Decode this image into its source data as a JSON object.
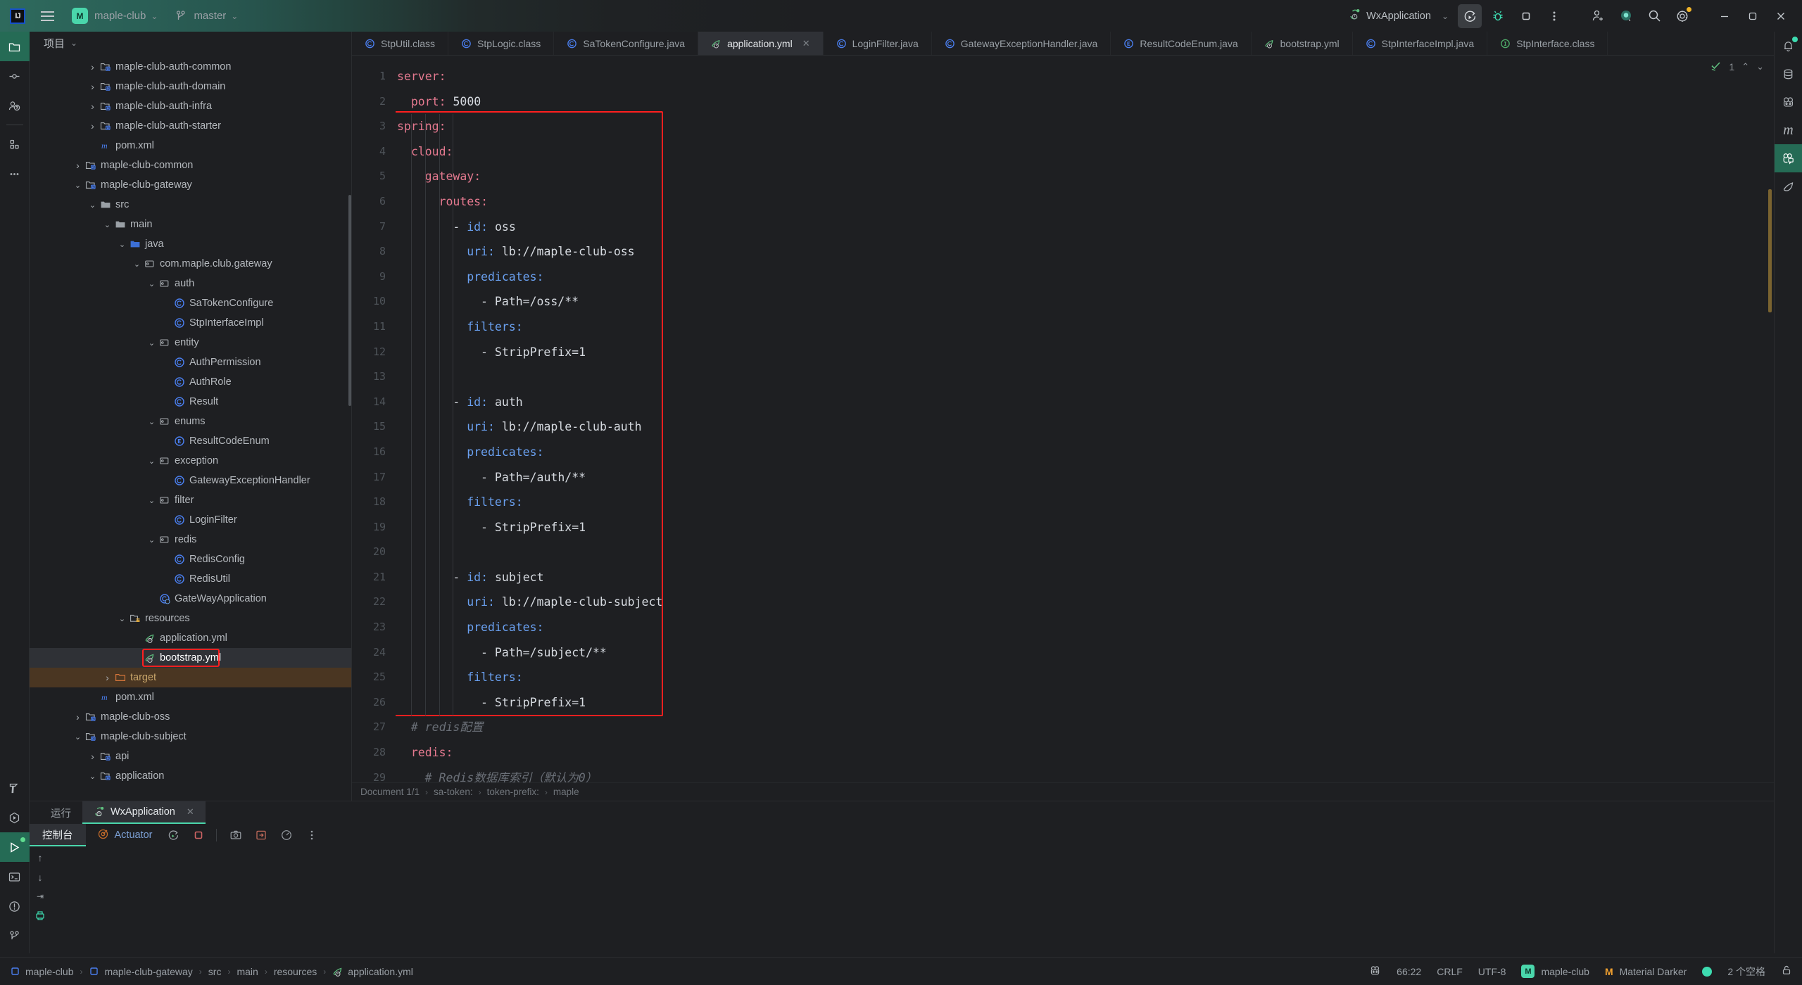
{
  "titlebar": {
    "app_icon": "intellij-idea-logo",
    "menu_icon": "hamburger-menu-icon",
    "project_badge": "M",
    "project_name": "maple-club",
    "branch_icon": "vcs-branch-icon",
    "branch_name": "master",
    "run_config": "WxApplication",
    "buttons": [
      {
        "name": "run-button",
        "icon": "run-with-coverage-icon"
      },
      {
        "name": "debug-button",
        "icon": "debug-bug-icon"
      },
      {
        "name": "stop-button",
        "icon": "stop-square-icon"
      },
      {
        "name": "more-button",
        "icon": "more-vertical-icon"
      },
      {
        "name": "share-button",
        "icon": "add-user-icon"
      },
      {
        "name": "ai-assistant-button",
        "icon": "ai-assistant-icon"
      },
      {
        "name": "search-button",
        "icon": "search-icon"
      },
      {
        "name": "settings-button",
        "icon": "gear-icon"
      },
      {
        "name": "minimize-button",
        "icon": "minimize-icon"
      },
      {
        "name": "maximize-button",
        "icon": "restore-window-icon"
      },
      {
        "name": "close-button",
        "icon": "close-x-icon"
      }
    ]
  },
  "left_rail": {
    "top": [
      {
        "name": "project-tool-button",
        "icon": "folder-icon",
        "selected": true
      },
      {
        "name": "commit-tool-button",
        "icon": "commit-node-icon",
        "selected": false
      },
      {
        "name": "pull-requests-button",
        "icon": "pull-request-icon",
        "selected": false
      },
      {
        "name": "services-button",
        "icon": "services-grid-icon",
        "selected": false
      },
      {
        "name": "more-tool-windows-button",
        "icon": "more-horizontal-icon",
        "selected": false
      }
    ],
    "bottom": [
      {
        "name": "build-tool-button",
        "icon": "hammer-icon",
        "selected": false
      },
      {
        "name": "run-anything-button",
        "icon": "play-hex-icon",
        "selected": false
      },
      {
        "name": "run-tool-button",
        "icon": "play-triangle-icon",
        "selected": true
      },
      {
        "name": "terminal-button",
        "icon": "terminal-icon",
        "selected": false
      },
      {
        "name": "problems-button",
        "icon": "warning-circle-icon",
        "selected": false
      },
      {
        "name": "version-control-button",
        "icon": "branch-icon",
        "selected": false
      }
    ]
  },
  "right_rail": {
    "items": [
      {
        "name": "notifications-button",
        "icon": "bell-icon",
        "badge": true
      },
      {
        "name": "database-button",
        "icon": "database-icon",
        "badge": false
      },
      {
        "name": "bean-validation-button",
        "icon": "spring-beans-icon",
        "badge": false
      },
      {
        "name": "maven-button",
        "icon": "maven-m-icon",
        "badge": false
      },
      {
        "name": "ai-chat-button",
        "icon": "ai-chat-icon",
        "badge": false,
        "selected": true
      },
      {
        "name": "spring-button",
        "icon": "spring-leaf-icon",
        "badge": false
      }
    ]
  },
  "project_panel": {
    "title": "项目",
    "caret_icon": "chevron-down-icon",
    "tree": [
      {
        "depth": 3,
        "label": "maple-club-auth-common",
        "icon": "module-folder-icon",
        "arrow": "collapsed"
      },
      {
        "depth": 3,
        "label": "maple-club-auth-domain",
        "icon": "module-folder-icon",
        "arrow": "collapsed"
      },
      {
        "depth": 3,
        "label": "maple-club-auth-infra",
        "icon": "module-folder-icon",
        "arrow": "collapsed"
      },
      {
        "depth": 3,
        "label": "maple-club-auth-starter",
        "icon": "module-folder-icon",
        "arrow": "collapsed"
      },
      {
        "depth": 3,
        "label": "pom.xml",
        "icon": "maven-pom-icon",
        "arrow": "none"
      },
      {
        "depth": 2,
        "label": "maple-club-common",
        "icon": "module-folder-icon",
        "arrow": "collapsed"
      },
      {
        "depth": 2,
        "label": "maple-club-gateway",
        "icon": "module-folder-icon",
        "arrow": "expanded"
      },
      {
        "depth": 3,
        "label": "src",
        "icon": "folder-icon",
        "arrow": "expanded"
      },
      {
        "depth": 4,
        "label": "main",
        "icon": "folder-icon",
        "arrow": "expanded"
      },
      {
        "depth": 5,
        "label": "java",
        "icon": "source-folder-icon",
        "arrow": "expanded"
      },
      {
        "depth": 6,
        "label": "com.maple.club.gateway",
        "icon": "package-icon",
        "arrow": "expanded"
      },
      {
        "depth": 7,
        "label": "auth",
        "icon": "package-icon",
        "arrow": "expanded"
      },
      {
        "depth": 8,
        "label": "SaTokenConfigure",
        "icon": "java-class-icon",
        "arrow": "none"
      },
      {
        "depth": 8,
        "label": "StpInterfaceImpl",
        "icon": "java-class-icon",
        "arrow": "none"
      },
      {
        "depth": 7,
        "label": "entity",
        "icon": "package-icon",
        "arrow": "expanded"
      },
      {
        "depth": 8,
        "label": "AuthPermission",
        "icon": "java-class-icon",
        "arrow": "none"
      },
      {
        "depth": 8,
        "label": "AuthRole",
        "icon": "java-class-icon",
        "arrow": "none"
      },
      {
        "depth": 8,
        "label": "Result",
        "icon": "java-class-icon",
        "arrow": "none"
      },
      {
        "depth": 7,
        "label": "enums",
        "icon": "package-icon",
        "arrow": "expanded"
      },
      {
        "depth": 8,
        "label": "ResultCodeEnum",
        "icon": "java-enum-icon",
        "arrow": "none"
      },
      {
        "depth": 7,
        "label": "exception",
        "icon": "package-icon",
        "arrow": "expanded"
      },
      {
        "depth": 8,
        "label": "GatewayExceptionHandler",
        "icon": "java-class-icon",
        "arrow": "none"
      },
      {
        "depth": 7,
        "label": "filter",
        "icon": "package-icon",
        "arrow": "expanded"
      },
      {
        "depth": 8,
        "label": "LoginFilter",
        "icon": "java-class-icon",
        "arrow": "none"
      },
      {
        "depth": 7,
        "label": "redis",
        "icon": "package-icon",
        "arrow": "expanded"
      },
      {
        "depth": 8,
        "label": "RedisConfig",
        "icon": "java-class-icon",
        "arrow": "none"
      },
      {
        "depth": 8,
        "label": "RedisUtil",
        "icon": "java-class-icon",
        "arrow": "none"
      },
      {
        "depth": 7,
        "label": "GateWayApplication",
        "icon": "spring-boot-class-icon",
        "arrow": "none"
      },
      {
        "depth": 5,
        "label": "resources",
        "icon": "resources-folder-icon",
        "arrow": "expanded"
      },
      {
        "depth": 6,
        "label": "application.yml",
        "icon": "spring-yaml-icon",
        "arrow": "none"
      },
      {
        "depth": 6,
        "label": "bootstrap.yml",
        "icon": "spring-yaml-icon",
        "arrow": "none",
        "boxed": true,
        "selected": true
      },
      {
        "depth": 4,
        "label": "target",
        "icon": "excluded-folder-icon",
        "arrow": "collapsed",
        "excluded": true
      },
      {
        "depth": 3,
        "label": "pom.xml",
        "icon": "maven-pom-icon",
        "arrow": "none"
      },
      {
        "depth": 2,
        "label": "maple-club-oss",
        "icon": "module-folder-icon",
        "arrow": "collapsed"
      },
      {
        "depth": 2,
        "label": "maple-club-subject",
        "icon": "module-folder-icon",
        "arrow": "expanded"
      },
      {
        "depth": 3,
        "label": "api",
        "icon": "module-folder-icon",
        "arrow": "collapsed"
      },
      {
        "depth": 3,
        "label": "application",
        "icon": "module-folder-icon",
        "arrow": "expanded"
      }
    ]
  },
  "editor_tabs": [
    {
      "label": "StpUtil.class",
      "icon": "java-class-icon",
      "active": false,
      "closable": false
    },
    {
      "label": "StpLogic.class",
      "icon": "java-class-icon",
      "active": false,
      "closable": false
    },
    {
      "label": "SaTokenConfigure.java",
      "icon": "java-class-icon",
      "active": false,
      "closable": false
    },
    {
      "label": "application.yml",
      "icon": "spring-yaml-icon",
      "active": true,
      "closable": true
    },
    {
      "label": "LoginFilter.java",
      "icon": "java-class-icon",
      "active": false,
      "closable": false
    },
    {
      "label": "GatewayExceptionHandler.java",
      "icon": "java-class-icon",
      "active": false,
      "closable": false
    },
    {
      "label": "ResultCodeEnum.java",
      "icon": "java-enum-icon",
      "active": false,
      "closable": false
    },
    {
      "label": "bootstrap.yml",
      "icon": "spring-yaml-icon",
      "active": false,
      "closable": false
    },
    {
      "label": "StpInterfaceImpl.java",
      "icon": "java-class-icon",
      "active": false,
      "closable": false
    },
    {
      "label": "StpInterface.class",
      "icon": "java-interface-icon",
      "active": false,
      "closable": false
    }
  ],
  "editor": {
    "inspection_count": "1",
    "inspection_icon": "inspection-check-icon",
    "prev_icon": "chevron-up-icon",
    "next_icon": "chevron-down-icon",
    "lines": [
      {
        "n": 1,
        "indent": 0,
        "tokens": [
          {
            "t": "server",
            "c": "k"
          },
          {
            "t": ":",
            "c": "k"
          }
        ]
      },
      {
        "n": 2,
        "indent": 1,
        "tokens": [
          {
            "t": "port",
            "c": "k"
          },
          {
            "t": ":",
            "c": "k"
          },
          {
            "t": " 5000",
            "c": "v"
          }
        ]
      },
      {
        "n": 3,
        "indent": 0,
        "tokens": [
          {
            "t": "spring",
            "c": "k"
          },
          {
            "t": ":",
            "c": "k"
          }
        ]
      },
      {
        "n": 4,
        "indent": 1,
        "tokens": [
          {
            "t": "cloud",
            "c": "k"
          },
          {
            "t": ":",
            "c": "k"
          }
        ]
      },
      {
        "n": 5,
        "indent": 2,
        "tokens": [
          {
            "t": "gateway",
            "c": "k"
          },
          {
            "t": ":",
            "c": "k"
          }
        ]
      },
      {
        "n": 6,
        "indent": 3,
        "tokens": [
          {
            "t": "routes",
            "c": "k"
          },
          {
            "t": ":",
            "c": "k"
          }
        ]
      },
      {
        "n": 7,
        "indent": 4,
        "tokens": [
          {
            "t": "- ",
            "c": "dash"
          },
          {
            "t": "id",
            "c": "k2"
          },
          {
            "t": ":",
            "c": "k2"
          },
          {
            "t": " oss",
            "c": "v"
          }
        ]
      },
      {
        "n": 8,
        "indent": 5,
        "tokens": [
          {
            "t": "uri",
            "c": "k2"
          },
          {
            "t": ":",
            "c": "k2"
          },
          {
            "t": " lb://maple-club-oss",
            "c": "v"
          }
        ]
      },
      {
        "n": 9,
        "indent": 5,
        "tokens": [
          {
            "t": "predicates",
            "c": "k2"
          },
          {
            "t": ":",
            "c": "k2"
          }
        ]
      },
      {
        "n": 10,
        "indent": 6,
        "tokens": [
          {
            "t": "- Path=/oss/**",
            "c": "v"
          }
        ]
      },
      {
        "n": 11,
        "indent": 5,
        "tokens": [
          {
            "t": "filters",
            "c": "k2"
          },
          {
            "t": ":",
            "c": "k2"
          }
        ]
      },
      {
        "n": 12,
        "indent": 6,
        "tokens": [
          {
            "t": "- StripPrefix=1",
            "c": "v"
          }
        ]
      },
      {
        "n": 13,
        "indent": 0,
        "tokens": []
      },
      {
        "n": 14,
        "indent": 4,
        "tokens": [
          {
            "t": "- ",
            "c": "dash"
          },
          {
            "t": "id",
            "c": "k2"
          },
          {
            "t": ":",
            "c": "k2"
          },
          {
            "t": " auth",
            "c": "v"
          }
        ]
      },
      {
        "n": 15,
        "indent": 5,
        "tokens": [
          {
            "t": "uri",
            "c": "k2"
          },
          {
            "t": ":",
            "c": "k2"
          },
          {
            "t": " lb://maple-club-auth",
            "c": "v"
          }
        ]
      },
      {
        "n": 16,
        "indent": 5,
        "tokens": [
          {
            "t": "predicates",
            "c": "k2"
          },
          {
            "t": ":",
            "c": "k2"
          }
        ]
      },
      {
        "n": 17,
        "indent": 5,
        "tokens": [
          {
            "t": "  - Path=/auth/**",
            "c": "v"
          }
        ]
      },
      {
        "n": 18,
        "indent": 5,
        "tokens": [
          {
            "t": "filters",
            "c": "k2"
          },
          {
            "t": ":",
            "c": "k2"
          }
        ]
      },
      {
        "n": 19,
        "indent": 5,
        "tokens": [
          {
            "t": "  - StripPrefix=1",
            "c": "v"
          }
        ]
      },
      {
        "n": 20,
        "indent": 0,
        "tokens": []
      },
      {
        "n": 21,
        "indent": 4,
        "tokens": [
          {
            "t": "- ",
            "c": "dash"
          },
          {
            "t": "id",
            "c": "k2"
          },
          {
            "t": ":",
            "c": "k2"
          },
          {
            "t": " subject",
            "c": "v"
          }
        ]
      },
      {
        "n": 22,
        "indent": 5,
        "tokens": [
          {
            "t": "uri",
            "c": "k2"
          },
          {
            "t": ":",
            "c": "k2"
          },
          {
            "t": " lb://maple-club-subject",
            "c": "v"
          }
        ]
      },
      {
        "n": 23,
        "indent": 5,
        "tokens": [
          {
            "t": "predicates",
            "c": "k2"
          },
          {
            "t": ":",
            "c": "k2"
          }
        ]
      },
      {
        "n": 24,
        "indent": 5,
        "tokens": [
          {
            "t": "  - Path=/subject/**",
            "c": "v"
          }
        ]
      },
      {
        "n": 25,
        "indent": 5,
        "tokens": [
          {
            "t": "filters",
            "c": "k2"
          },
          {
            "t": ":",
            "c": "k2"
          }
        ]
      },
      {
        "n": 26,
        "indent": 5,
        "tokens": [
          {
            "t": "  - StripPrefix=1",
            "c": "v"
          }
        ]
      },
      {
        "n": 27,
        "indent": 1,
        "tokens": [
          {
            "t": "# redis配置",
            "c": "cmt"
          }
        ]
      },
      {
        "n": 28,
        "indent": 1,
        "tokens": [
          {
            "t": "redis",
            "c": "k"
          },
          {
            "t": ":",
            "c": "k"
          }
        ]
      },
      {
        "n": 29,
        "indent": 2,
        "tokens": [
          {
            "t": "# Redis数据库索引（默认为0）",
            "c": "cmt"
          }
        ]
      }
    ]
  },
  "breadcrumb": {
    "items": [
      "Document 1/1",
      "sa-token:",
      "token-prefix:",
      "maple"
    ]
  },
  "bottom_panel": {
    "tabs": [
      {
        "label": "运行",
        "active": false,
        "icon": null,
        "closable": false
      },
      {
        "label": "WxApplication",
        "active": true,
        "icon": "spring-boot-run-icon",
        "closable": true
      }
    ],
    "console_tab": "控制台",
    "actuator_tab": "Actuator",
    "actuator_icon": "actuator-target-icon",
    "toolbar_buttons": [
      {
        "name": "rerun-button",
        "icon": "rerun-icon"
      },
      {
        "name": "stop-button",
        "icon": "stop-square-icon"
      },
      {
        "name": "screenshot-button",
        "icon": "camera-icon"
      },
      {
        "name": "export-button",
        "icon": "export-arrow-icon"
      },
      {
        "name": "profiler-button",
        "icon": "gauge-icon"
      },
      {
        "name": "more-options-button",
        "icon": "more-vertical-icon"
      }
    ],
    "side_buttons": [
      {
        "name": "scroll-up-button",
        "icon": "arrow-up-icon"
      },
      {
        "name": "scroll-down-button",
        "icon": "arrow-down-icon"
      },
      {
        "name": "soft-wrap-button",
        "icon": "soft-wrap-icon"
      },
      {
        "name": "print-button",
        "icon": "printer-icon"
      }
    ]
  },
  "statusbar": {
    "breadcrumb": [
      {
        "label": "maple-club",
        "icon": "module-square-icon"
      },
      {
        "label": "maple-club-gateway",
        "icon": "module-square-icon"
      },
      {
        "label": "src",
        "icon": null
      },
      {
        "label": "main",
        "icon": null
      },
      {
        "label": "resources",
        "icon": null
      },
      {
        "label": "application.yml",
        "icon": "spring-yaml-icon"
      }
    ],
    "right": {
      "spring_icon": "spring-beans-icon",
      "caret_position": "66:22",
      "line_separator": "CRLF",
      "encoding": "UTF-8",
      "project_badge": "M",
      "project_name": "maple-club",
      "theme_icon": "material-theme-icon",
      "theme_name": "Material Darker",
      "indicator_icon": "status-dot-icon",
      "indent": "2 个空格",
      "lock_icon": "unlocked-icon"
    }
  },
  "colors": {
    "accent_teal": "#4ad6ab",
    "selection_green": "#256b55",
    "highlight_red": "#ff1f1f",
    "excluded_orange": "#c8a56a",
    "yaml_key": "#e4798f",
    "yaml_nested_key": "#6aa0f0",
    "yaml_value": "#d6dae0",
    "comment": "#6b7078",
    "bg": "#1e1f22"
  }
}
